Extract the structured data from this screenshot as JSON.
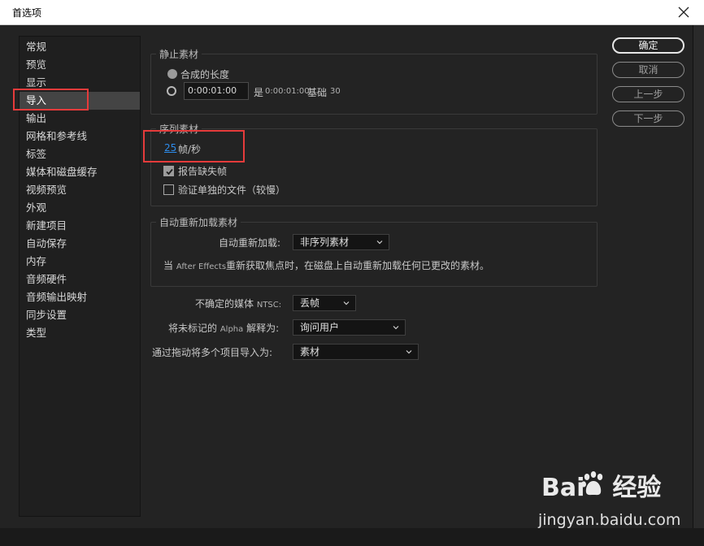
{
  "window": {
    "title": "首选项"
  },
  "sidebar": {
    "items": [
      {
        "label": "常规"
      },
      {
        "label": "预览"
      },
      {
        "label": "显示"
      },
      {
        "label": "导入"
      },
      {
        "label": "输出"
      },
      {
        "label": "网格和参考线"
      },
      {
        "label": "标签"
      },
      {
        "label": "媒体和磁盘缓存"
      },
      {
        "label": "视频预览"
      },
      {
        "label": "外观"
      },
      {
        "label": "新建项目"
      },
      {
        "label": "自动保存"
      },
      {
        "label": "内存"
      },
      {
        "label": "音频硬件"
      },
      {
        "label": "音频输出映射"
      },
      {
        "label": "同步设置"
      },
      {
        "label": "类型"
      }
    ],
    "active_index": 3
  },
  "still": {
    "title": "静止素材",
    "opt1_label": "合成的长度",
    "duration_value": "0:00:01:00",
    "is_label": "是",
    "is_value": "0:00:01:00",
    "base_label": "基础",
    "base_value": "30"
  },
  "sequence": {
    "title": "序列素材",
    "fps_value": "25",
    "fps_unit": "帧/秒",
    "report_missing": "报告缺失帧",
    "report_missing_checked": true,
    "verify_single": "验证单独的文件（较慢）",
    "verify_single_checked": false
  },
  "reload": {
    "title": "自动重新加载素材",
    "label": "自动重新加载:",
    "value": "非序列素材",
    "note_prefix": "当",
    "note_app": "After Effects",
    "note_suffix": "重新获取焦点时，在磁盘上自动重新加载任何已更改的素材。"
  },
  "ntsc": {
    "label_prefix": "不确定的媒体",
    "label_suffix": "NTSC:",
    "value": "丢帧"
  },
  "alpha": {
    "label_prefix": "将未标记的",
    "label_mid": "Alpha",
    "label_suffix": "解释为:",
    "value": "询问用户"
  },
  "drag": {
    "label": "通过拖动将多个项目导入为:",
    "value": "素材"
  },
  "buttons": {
    "ok": "确定",
    "cancel": "取消",
    "prev": "上一步",
    "next": "下一步"
  },
  "watermark": {
    "brand": "Bai",
    "brand2": "经验",
    "url": "jingyan.baidu.com"
  }
}
